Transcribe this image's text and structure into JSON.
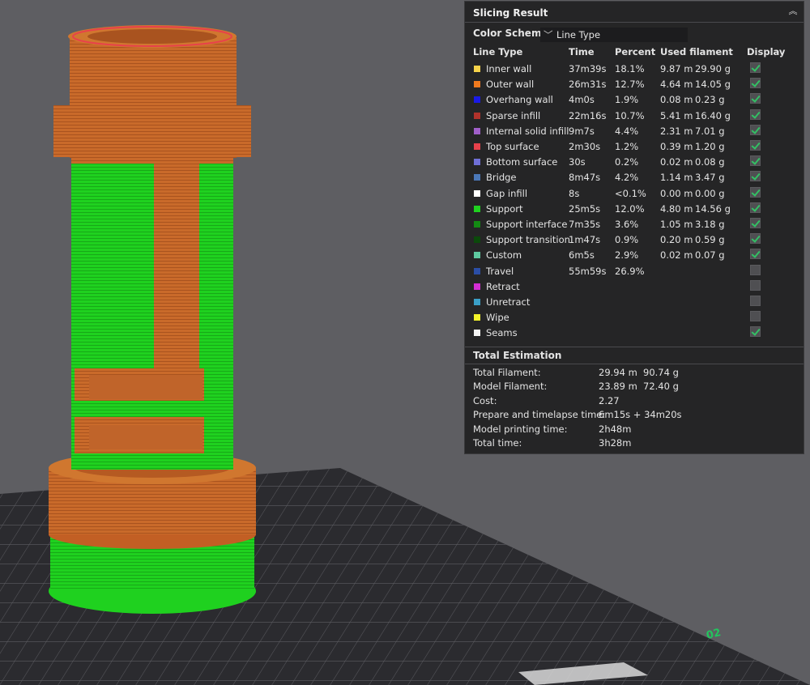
{
  "panel": {
    "title": "Slicing Result",
    "color_scheme_label": "Color Scheme",
    "color_scheme_value": "Line Type",
    "headers": {
      "line_type": "Line Type",
      "time": "Time",
      "percent": "Percent",
      "used_filament": "Used filament",
      "display": "Display"
    },
    "rows": [
      {
        "name": "Inner wall",
        "color": "#f5d24a",
        "time": "37m39s",
        "percent": "18.1%",
        "length": "9.87 m",
        "weight": "29.90 g",
        "display": true
      },
      {
        "name": "Outer wall",
        "color": "#f07a1e",
        "time": "26m31s",
        "percent": "12.7%",
        "length": "4.64 m",
        "weight": "14.05 g",
        "display": true
      },
      {
        "name": "Overhang wall",
        "color": "#1a1ae6",
        "time": "4m0s",
        "percent": "1.9%",
        "length": "0.08 m",
        "weight": "0.23 g",
        "display": true
      },
      {
        "name": "Sparse infill",
        "color": "#b1322b",
        "time": "22m16s",
        "percent": "10.7%",
        "length": "5.41 m",
        "weight": "16.40 g",
        "display": true
      },
      {
        "name": "Internal solid infill",
        "color": "#a05fc9",
        "time": "9m7s",
        "percent": "4.4%",
        "length": "2.31 m",
        "weight": "7.01 g",
        "display": true
      },
      {
        "name": "Top surface",
        "color": "#e8414b",
        "time": "2m30s",
        "percent": "1.2%",
        "length": "0.39 m",
        "weight": "1.20 g",
        "display": true
      },
      {
        "name": "Bottom surface",
        "color": "#6f6fd6",
        "time": "30s",
        "percent": "0.2%",
        "length": "0.02 m",
        "weight": "0.08 g",
        "display": true
      },
      {
        "name": "Bridge",
        "color": "#4b78b8",
        "time": "8m47s",
        "percent": "4.2%",
        "length": "1.14 m",
        "weight": "3.47 g",
        "display": true
      },
      {
        "name": "Gap infill",
        "color": "#ffffff",
        "time": "8s",
        "percent": "<0.1%",
        "length": "0.00 m",
        "weight": "0.00 g",
        "display": true
      },
      {
        "name": "Support",
        "color": "#1fd11f",
        "time": "25m5s",
        "percent": "12.0%",
        "length": "4.80 m",
        "weight": "14.56 g",
        "display": true
      },
      {
        "name": "Support interface",
        "color": "#138a13",
        "time": "7m35s",
        "percent": "3.6%",
        "length": "1.05 m",
        "weight": "3.18 g",
        "display": true
      },
      {
        "name": "Support transition",
        "color": "#0b4a0b",
        "time": "1m47s",
        "percent": "0.9%",
        "length": "0.20 m",
        "weight": "0.59 g",
        "display": true
      },
      {
        "name": "Custom",
        "color": "#5ec9a0",
        "time": "6m5s",
        "percent": "2.9%",
        "length": "0.02 m",
        "weight": "0.07 g",
        "display": true
      },
      {
        "name": "Travel",
        "color": "#2b4ea6",
        "time": "55m59s",
        "percent": "26.9%",
        "length": "",
        "weight": "",
        "display": false
      },
      {
        "name": "Retract",
        "color": "#d42ed4",
        "time": "",
        "percent": "",
        "length": "",
        "weight": "",
        "display": false
      },
      {
        "name": "Unretract",
        "color": "#3a9fc7",
        "time": "",
        "percent": "",
        "length": "",
        "weight": "",
        "display": false
      },
      {
        "name": "Wipe",
        "color": "#f2f22a",
        "time": "",
        "percent": "",
        "length": "",
        "weight": "",
        "display": false
      },
      {
        "name": "Seams",
        "color": "#f4f4f4",
        "time": "",
        "percent": "",
        "length": "",
        "weight": "",
        "display": true
      }
    ],
    "totals_title": "Total Estimation",
    "totals": [
      {
        "label": "Total Filament:",
        "v1": "29.94 m",
        "v2": "90.74 g"
      },
      {
        "label": "Model Filament:",
        "v1": "23.89 m",
        "v2": "72.40 g"
      },
      {
        "label": "Cost:",
        "v1": "2.27",
        "v2": ""
      },
      {
        "label": "Prepare and timelapse time:",
        "v1": "6m15s + 34m20s",
        "v2": ""
      },
      {
        "label": "Model printing time:",
        "v1": "2h48m",
        "v2": ""
      },
      {
        "label": "Total time:",
        "v1": "3h28m",
        "v2": ""
      }
    ]
  },
  "bed": {
    "label": "02"
  },
  "colors": {
    "panel_bg": "#252526",
    "viewport_bg": "#5e5e62",
    "check": "#33c064",
    "bed_label": "#22c55e"
  }
}
